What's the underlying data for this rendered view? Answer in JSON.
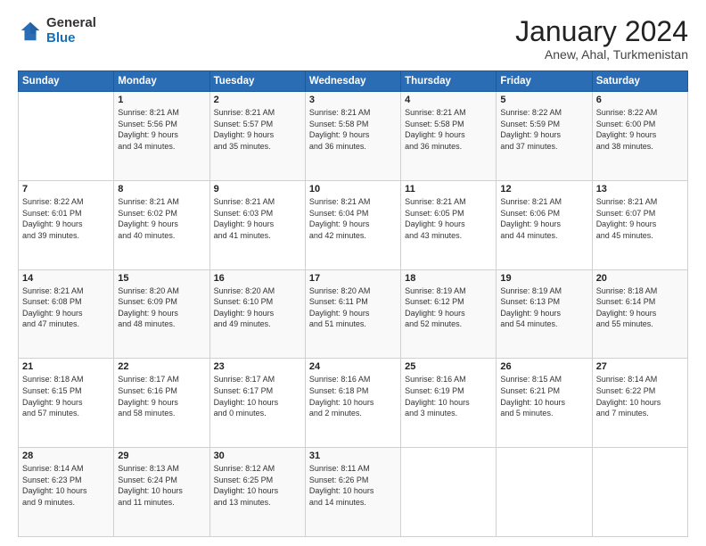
{
  "logo": {
    "general": "General",
    "blue": "Blue"
  },
  "title": "January 2024",
  "location": "Anew, Ahal, Turkmenistan",
  "headers": [
    "Sunday",
    "Monday",
    "Tuesday",
    "Wednesday",
    "Thursday",
    "Friday",
    "Saturday"
  ],
  "weeks": [
    [
      {
        "day": "",
        "info": ""
      },
      {
        "day": "1",
        "info": "Sunrise: 8:21 AM\nSunset: 5:56 PM\nDaylight: 9 hours\nand 34 minutes."
      },
      {
        "day": "2",
        "info": "Sunrise: 8:21 AM\nSunset: 5:57 PM\nDaylight: 9 hours\nand 35 minutes."
      },
      {
        "day": "3",
        "info": "Sunrise: 8:21 AM\nSunset: 5:58 PM\nDaylight: 9 hours\nand 36 minutes."
      },
      {
        "day": "4",
        "info": "Sunrise: 8:21 AM\nSunset: 5:58 PM\nDaylight: 9 hours\nand 36 minutes."
      },
      {
        "day": "5",
        "info": "Sunrise: 8:22 AM\nSunset: 5:59 PM\nDaylight: 9 hours\nand 37 minutes."
      },
      {
        "day": "6",
        "info": "Sunrise: 8:22 AM\nSunset: 6:00 PM\nDaylight: 9 hours\nand 38 minutes."
      }
    ],
    [
      {
        "day": "7",
        "info": "Sunrise: 8:22 AM\nSunset: 6:01 PM\nDaylight: 9 hours\nand 39 minutes."
      },
      {
        "day": "8",
        "info": "Sunrise: 8:21 AM\nSunset: 6:02 PM\nDaylight: 9 hours\nand 40 minutes."
      },
      {
        "day": "9",
        "info": "Sunrise: 8:21 AM\nSunset: 6:03 PM\nDaylight: 9 hours\nand 41 minutes."
      },
      {
        "day": "10",
        "info": "Sunrise: 8:21 AM\nSunset: 6:04 PM\nDaylight: 9 hours\nand 42 minutes."
      },
      {
        "day": "11",
        "info": "Sunrise: 8:21 AM\nSunset: 6:05 PM\nDaylight: 9 hours\nand 43 minutes."
      },
      {
        "day": "12",
        "info": "Sunrise: 8:21 AM\nSunset: 6:06 PM\nDaylight: 9 hours\nand 44 minutes."
      },
      {
        "day": "13",
        "info": "Sunrise: 8:21 AM\nSunset: 6:07 PM\nDaylight: 9 hours\nand 45 minutes."
      }
    ],
    [
      {
        "day": "14",
        "info": "Sunrise: 8:21 AM\nSunset: 6:08 PM\nDaylight: 9 hours\nand 47 minutes."
      },
      {
        "day": "15",
        "info": "Sunrise: 8:20 AM\nSunset: 6:09 PM\nDaylight: 9 hours\nand 48 minutes."
      },
      {
        "day": "16",
        "info": "Sunrise: 8:20 AM\nSunset: 6:10 PM\nDaylight: 9 hours\nand 49 minutes."
      },
      {
        "day": "17",
        "info": "Sunrise: 8:20 AM\nSunset: 6:11 PM\nDaylight: 9 hours\nand 51 minutes."
      },
      {
        "day": "18",
        "info": "Sunrise: 8:19 AM\nSunset: 6:12 PM\nDaylight: 9 hours\nand 52 minutes."
      },
      {
        "day": "19",
        "info": "Sunrise: 8:19 AM\nSunset: 6:13 PM\nDaylight: 9 hours\nand 54 minutes."
      },
      {
        "day": "20",
        "info": "Sunrise: 8:18 AM\nSunset: 6:14 PM\nDaylight: 9 hours\nand 55 minutes."
      }
    ],
    [
      {
        "day": "21",
        "info": "Sunrise: 8:18 AM\nSunset: 6:15 PM\nDaylight: 9 hours\nand 57 minutes."
      },
      {
        "day": "22",
        "info": "Sunrise: 8:17 AM\nSunset: 6:16 PM\nDaylight: 9 hours\nand 58 minutes."
      },
      {
        "day": "23",
        "info": "Sunrise: 8:17 AM\nSunset: 6:17 PM\nDaylight: 10 hours\nand 0 minutes."
      },
      {
        "day": "24",
        "info": "Sunrise: 8:16 AM\nSunset: 6:18 PM\nDaylight: 10 hours\nand 2 minutes."
      },
      {
        "day": "25",
        "info": "Sunrise: 8:16 AM\nSunset: 6:19 PM\nDaylight: 10 hours\nand 3 minutes."
      },
      {
        "day": "26",
        "info": "Sunrise: 8:15 AM\nSunset: 6:21 PM\nDaylight: 10 hours\nand 5 minutes."
      },
      {
        "day": "27",
        "info": "Sunrise: 8:14 AM\nSunset: 6:22 PM\nDaylight: 10 hours\nand 7 minutes."
      }
    ],
    [
      {
        "day": "28",
        "info": "Sunrise: 8:14 AM\nSunset: 6:23 PM\nDaylight: 10 hours\nand 9 minutes."
      },
      {
        "day": "29",
        "info": "Sunrise: 8:13 AM\nSunset: 6:24 PM\nDaylight: 10 hours\nand 11 minutes."
      },
      {
        "day": "30",
        "info": "Sunrise: 8:12 AM\nSunset: 6:25 PM\nDaylight: 10 hours\nand 13 minutes."
      },
      {
        "day": "31",
        "info": "Sunrise: 8:11 AM\nSunset: 6:26 PM\nDaylight: 10 hours\nand 14 minutes."
      },
      {
        "day": "",
        "info": ""
      },
      {
        "day": "",
        "info": ""
      },
      {
        "day": "",
        "info": ""
      }
    ]
  ]
}
